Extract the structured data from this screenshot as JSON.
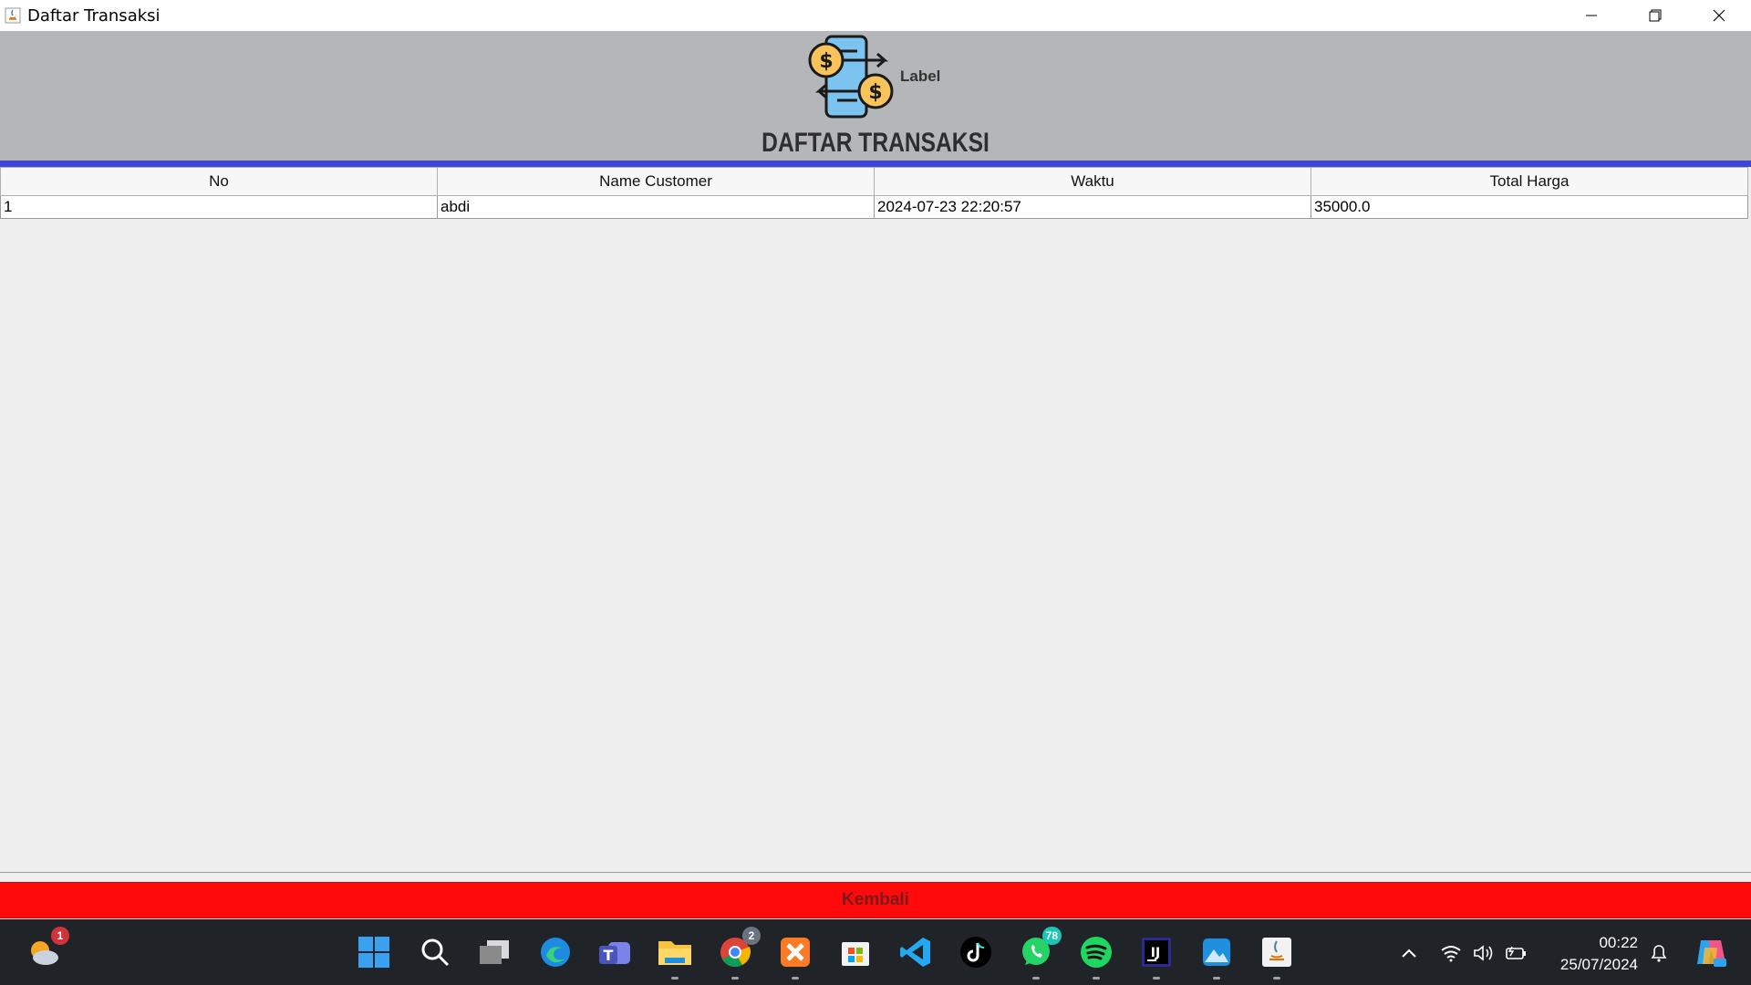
{
  "window": {
    "title": "Daftar Transaksi"
  },
  "header": {
    "logo_label": "Label",
    "title": "DAFTAR TRANSAKSI"
  },
  "table": {
    "columns": [
      "No",
      "Name Customer",
      "Waktu",
      "Total Harga"
    ],
    "rows": [
      [
        "1",
        "abdi",
        "2024-07-23 22:20:57",
        "35000.0"
      ]
    ]
  },
  "back_button": {
    "label": "Kembali"
  },
  "taskbar": {
    "weather_badge": "1",
    "chrome_badge": "2",
    "whatsapp_badge": "78",
    "clock_time": "00:22",
    "clock_date": "25/07/2024"
  },
  "colors": {
    "header_bg": "#b5b6b9",
    "header_rule": "#3d45d8",
    "back_button_bg": "#ff0a0a",
    "taskbar_bg": "#202327"
  }
}
